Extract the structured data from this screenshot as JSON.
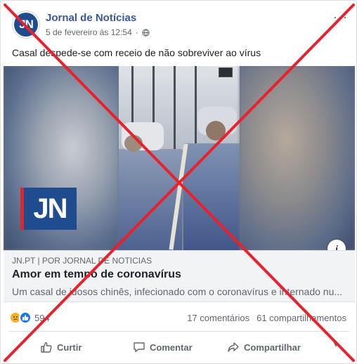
{
  "post": {
    "page_name": "Jornal de Notícias",
    "avatar_text": "JN",
    "timestamp": "5 de fevereiro às 12:54",
    "privacy_icon": "globe-icon",
    "more_label": "···",
    "text": "Casal despede-se com receio de não sobreviver ao vírus"
  },
  "media": {
    "logo_text": "JN",
    "info_label": "i"
  },
  "link": {
    "domain": "JN.PT  |  POR JORNAL DE NOTICIAS",
    "title": "Amor em tempo de coronavírus",
    "description": "Um casal de idosos chinês, infecionado com o coronavírus e internado nu..."
  },
  "stats": {
    "reaction_count": "594",
    "reactions": [
      "sad-reaction-icon",
      "like-reaction-icon"
    ],
    "comments": "17 comentários",
    "shares": "61 compartilhamentos"
  },
  "actions": {
    "like_label": "Curtir",
    "comment_label": "Comentar",
    "share_label": "Compartilhar"
  },
  "colors": {
    "page_name": "#385898",
    "brand_blue": "#1f4c8f",
    "brand_red": "#e0242f",
    "cross_red": "#e8212c",
    "like_blue": "#1877f2"
  }
}
